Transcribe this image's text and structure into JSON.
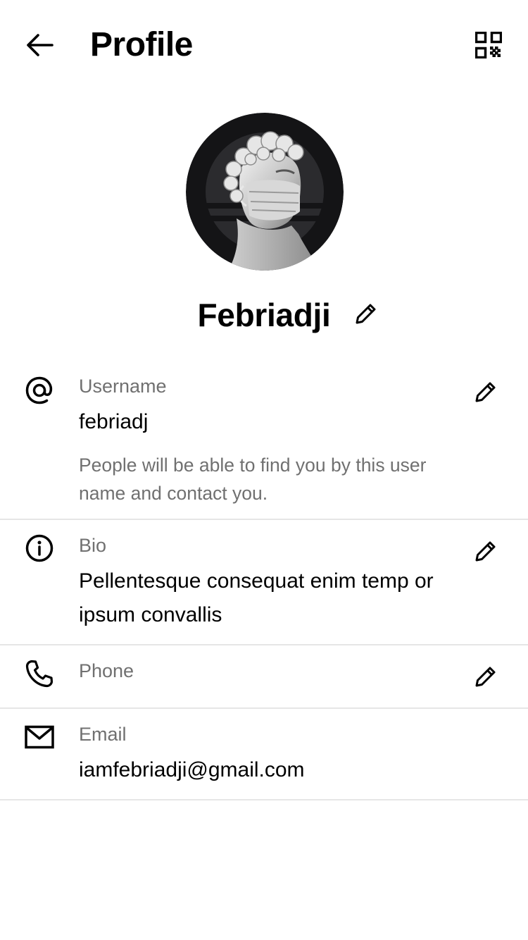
{
  "header": {
    "title": "Profile",
    "back_icon": "arrow-left-icon",
    "qr_icon": "qr-code-icon"
  },
  "profile": {
    "display_name": "Febriadji",
    "edit_icon": "pencil-icon"
  },
  "fields": {
    "username": {
      "icon": "at-sign-icon",
      "label": "Username",
      "value": "febriadj",
      "hint": "People will be able to find you by this user name and contact you."
    },
    "bio": {
      "icon": "info-icon",
      "label": "Bio",
      "value": "Pellentesque consequat enim temp or ipsum convallis"
    },
    "phone": {
      "icon": "phone-icon",
      "label": "Phone",
      "value": ""
    },
    "email": {
      "icon": "mail-icon",
      "label": "Email",
      "value": "iamfebriadji@gmail.com"
    }
  },
  "colors": {
    "text_primary": "#000000",
    "text_secondary": "#707070",
    "divider": "#e6e6e6",
    "avatar_bg": "#141416"
  }
}
